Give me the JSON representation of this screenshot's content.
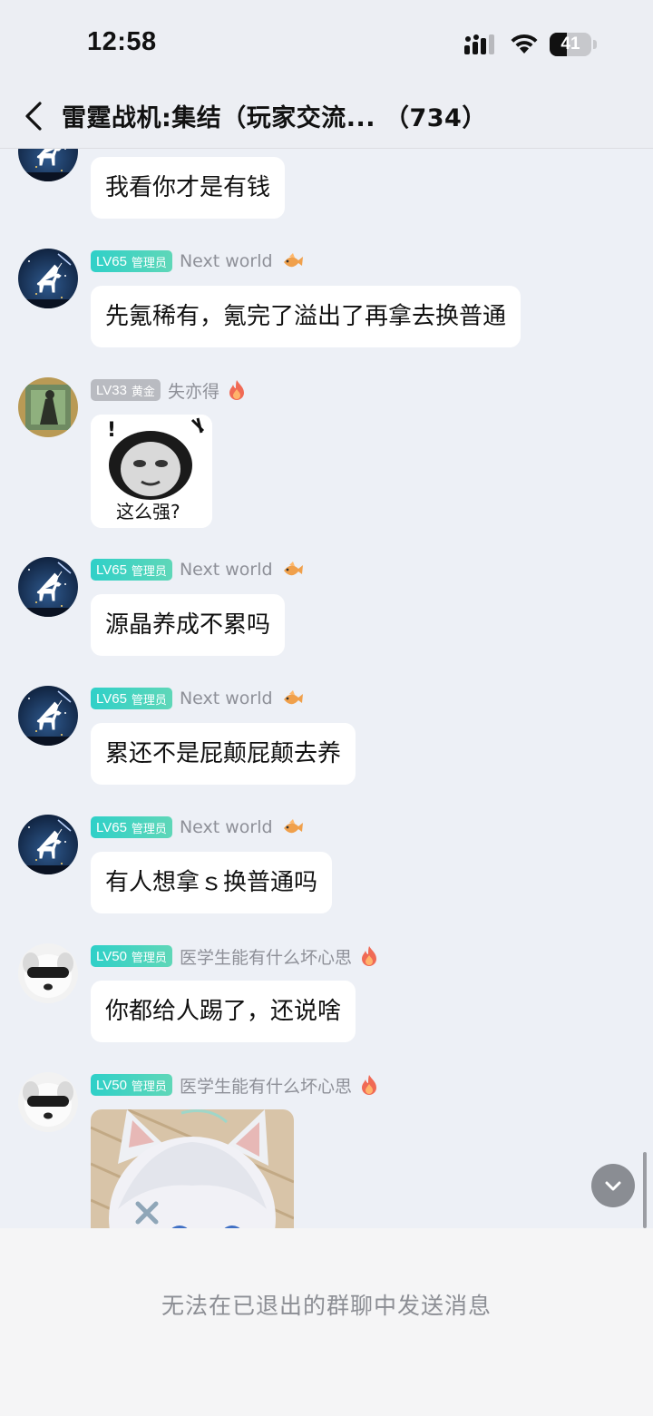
{
  "status_bar": {
    "time": "12:58",
    "battery_level": 41,
    "battery_text": "41",
    "signal_icon": "cellular-signal-icon",
    "wifi_icon": "wifi-icon"
  },
  "header": {
    "back_icon": "chevron-left-icon",
    "title": "雷霆战机:集结（玩家交流... （734）"
  },
  "messages": [
    {
      "sender": "Next world",
      "level": "LV65",
      "role": "管理员",
      "text": "我看你才是有钱"
    },
    {
      "sender": "Next world",
      "level": "LV65",
      "role": "管理员",
      "text": "先氪稀有，氪完了溢出了再拿去换普通"
    },
    {
      "sender": "失亦得",
      "level": "LV33",
      "role": "黄金",
      "sticker_caption": "这么强?",
      "sticker_mark": "!"
    },
    {
      "sender": "Next world",
      "level": "LV65",
      "role": "管理员",
      "text": "源晶养成不累吗"
    },
    {
      "sender": "Next world",
      "level": "LV65",
      "role": "管理员",
      "text": "累还不是屁颠屁颠去养"
    },
    {
      "sender": "Next world",
      "level": "LV65",
      "role": "管理员",
      "text": "有人想拿ｓ换普通吗"
    },
    {
      "sender": "医学生能有什么坏心思",
      "level": "LV50",
      "role": "管理员",
      "text": "你都给人踢了，还说啥"
    },
    {
      "sender": "医学生能有什么坏心思",
      "level": "LV50",
      "role": "管理员",
      "image": "anime-cat-girl-sticker"
    }
  ],
  "footer": {
    "notice": "无法在已退出的群聊中发送消息"
  },
  "scroll_button_icon": "chevron-down-icon",
  "colors": {
    "background": "#edf0f6",
    "admin_badge": "#2fd0c8",
    "gold_badge": "#b9bbc1",
    "bubble": "#ffffff"
  }
}
